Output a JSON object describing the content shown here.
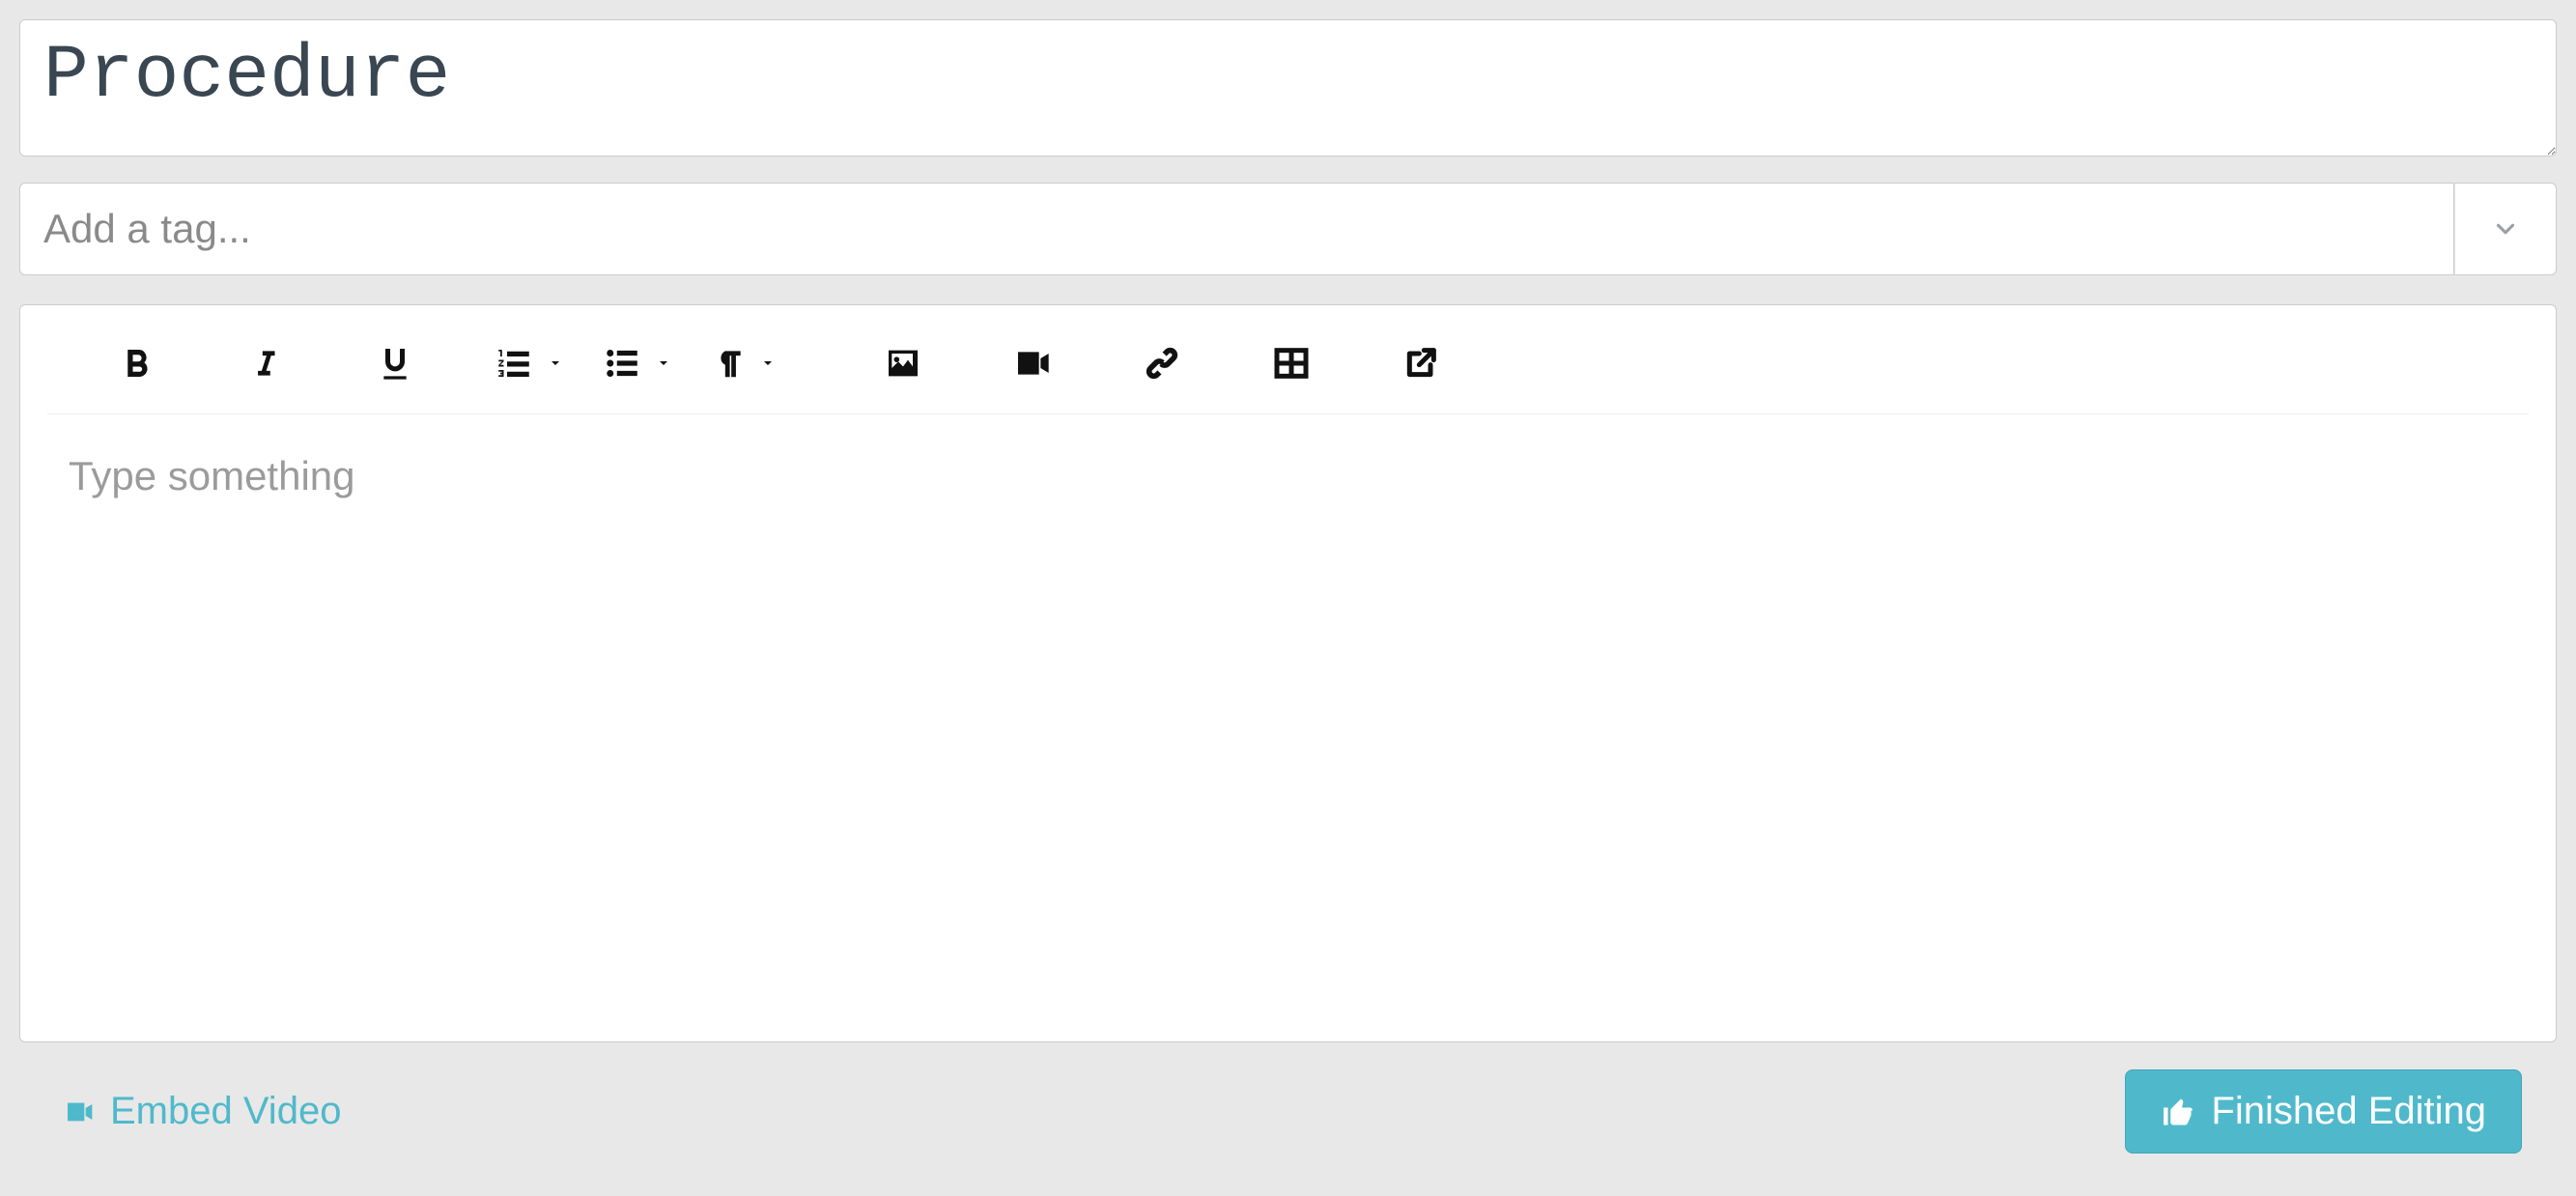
{
  "title": {
    "value": "Procedure"
  },
  "tags": {
    "placeholder": "Add a tag..."
  },
  "editor": {
    "placeholder": "Type something"
  },
  "footer": {
    "embed_label": "Embed Video",
    "finish_label": "Finished Editing"
  },
  "colors": {
    "accent": "#4fb9cb",
    "text_muted": "#9b9b9b",
    "title_text": "#3a4752"
  }
}
